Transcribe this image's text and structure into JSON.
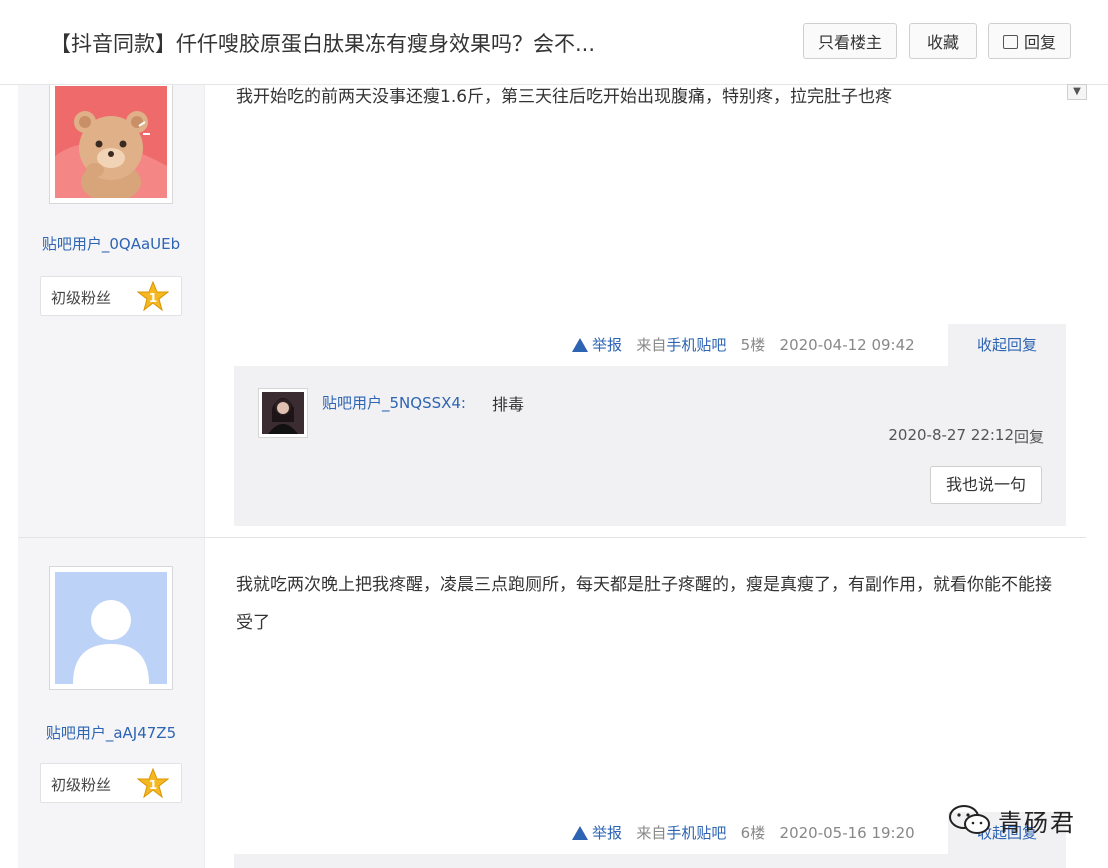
{
  "header": {
    "title": "【抖音同款】仟仟嗖胶原蛋白肽果冻有瘦身效果吗？会不...",
    "only_owner_label": "只看楼主",
    "favorite_label": "收藏",
    "reply_label": "回复"
  },
  "posts": [
    {
      "user": "贴吧用户_0QAaUEb",
      "level": "初级粉丝",
      "level_num": "1",
      "content": "我开始吃的前两天没事还瘦1.6斤，第三天往后吃开始出现腹痛，特别疼，拉完肚子也疼",
      "report": "举报",
      "from_prefix": "来自",
      "from_client": "手机贴吧",
      "floor": "5楼",
      "time": "2020-04-12 09:42",
      "collapse_label": "收起回复",
      "replies": [
        {
          "user": "贴吧用户_5NQSSX4:",
          "text": "排毒",
          "time": "2020-8-27 22:12",
          "reply_label": "回复"
        }
      ],
      "say_label": "我也说一句"
    },
    {
      "user": "贴吧用户_aAJ47Z5",
      "level": "初级粉丝",
      "level_num": "1",
      "content": "我就吃两次晚上把我疼醒，凌晨三点跑厕所，每天都是肚子疼醒的，瘦是真瘦了，有副作用，就看你能不能接受了",
      "report": "举报",
      "from_prefix": "来自",
      "from_client": "手机贴吧",
      "floor": "6楼",
      "time": "2020-05-16 19:20",
      "collapse_label": "收起回复"
    }
  ],
  "watermark": {
    "text": "青砀君"
  },
  "colors": {
    "link": "#2d64b3",
    "sidebar": "#f5f5f7",
    "panel": "#f1f1f3",
    "badge": "#f6b820"
  }
}
